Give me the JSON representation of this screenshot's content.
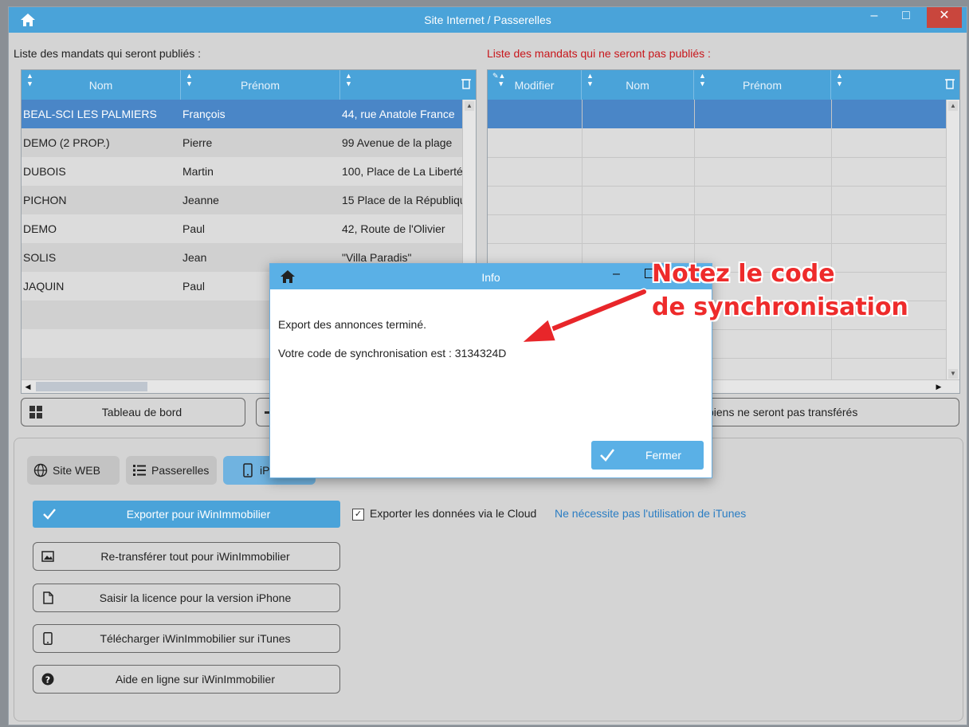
{
  "window": {
    "title": "Site Internet / Passerelles",
    "minimize": "–",
    "maximize": "□",
    "close": "✕"
  },
  "left_panel": {
    "label": "Liste des mandats qui seront publiés :",
    "columns": [
      "Nom",
      "Prénom",
      ""
    ],
    "rows": [
      {
        "nom": "BEAL-SCI LES PALMIERS",
        "prenom": "François",
        "adresse": "44, rue Anatole France"
      },
      {
        "nom": "DEMO (2 PROP.)",
        "prenom": "Pierre",
        "adresse": "99 Avenue de la plage"
      },
      {
        "nom": "DUBOIS",
        "prenom": "Martin",
        "adresse": "100, Place de La Liberté"
      },
      {
        "nom": "PICHON",
        "prenom": "Jeanne",
        "adresse": "15 Place de la République"
      },
      {
        "nom": "DEMO",
        "prenom": "Paul",
        "adresse": "42, Route de l'Olivier"
      },
      {
        "nom": "SOLIS",
        "prenom": "Jean",
        "adresse": "\"Villa Paradis\""
      },
      {
        "nom": "JAQUIN",
        "prenom": "Paul",
        "adresse": ""
      }
    ]
  },
  "right_panel": {
    "label": "Liste des mandats qui ne seront pas publiés :",
    "columns": [
      "Modifier",
      "Nom",
      "Prénom",
      ""
    ]
  },
  "buttons": {
    "dashboard": "Tableau de bord",
    "not_transferred": "biens ne seront pas transférés"
  },
  "tabs": [
    {
      "label": "Site WEB",
      "icon": "globe-icon"
    },
    {
      "label": "Passerelles",
      "icon": "list-icon"
    },
    {
      "label": "iPhone",
      "icon": "phone-icon"
    }
  ],
  "actions": {
    "export": "Exporter pour iWinImmobilier",
    "retransfer": "Re-transférer tout pour iWinImmobilier",
    "license": "Saisir la licence pour la version iPhone",
    "download": "Télécharger iWinImmobilier sur iTunes",
    "help": "Aide en ligne sur iWinImmobilier"
  },
  "cloud": {
    "checked": true,
    "label": "Exporter les données via le Cloud",
    "note": "Ne nécessite pas l'utilisation de iTunes"
  },
  "dialog": {
    "title": "Info",
    "minimize": "–",
    "line1": "Export des annonces terminé.",
    "line2": "Votre code de synchronisation est : 3134324D",
    "close_button": "Fermer"
  },
  "annotation": {
    "line1": "Notez le code",
    "line2": "de synchronisation"
  },
  "colors": {
    "accent": "#4aa3d9",
    "selected_row": "#4a86c7",
    "warning_label": "#c8161b",
    "annotation": "#ee2b2b"
  }
}
